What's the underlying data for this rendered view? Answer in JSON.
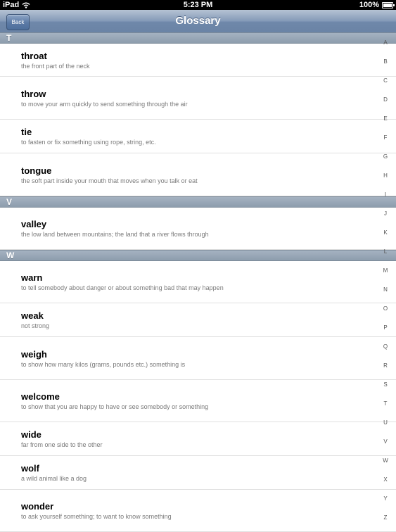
{
  "status_bar": {
    "device": "iPad",
    "time": "5:23 PM",
    "battery": "100%"
  },
  "nav": {
    "title": "Glossary",
    "back_label": "Back"
  },
  "sections": [
    {
      "letter": "T",
      "entries": [
        {
          "term": "throat",
          "definition": "the front part of the neck"
        },
        {
          "term": "throw",
          "definition": "to move your arm quickly to send something through the air"
        },
        {
          "term": "tie",
          "definition": "to fasten or fix something using rope, string, etc."
        },
        {
          "term": "tongue",
          "definition": "the soft part inside your mouth that moves when you talk or eat"
        }
      ]
    },
    {
      "letter": "V",
      "entries": [
        {
          "term": "valley",
          "definition": "the low land between mountains; the land that a river flows through"
        }
      ]
    },
    {
      "letter": "W",
      "entries": [
        {
          "term": "warn",
          "definition": "to tell somebody about danger or about something bad that may happen"
        },
        {
          "term": "weak",
          "definition": "not strong"
        },
        {
          "term": "weigh",
          "definition": "to show how many kilos (grams, pounds etc.) something is"
        },
        {
          "term": "welcome",
          "definition": "to show that you are happy to have or see somebody or something"
        },
        {
          "term": "wide",
          "definition": "far from one side to the other"
        },
        {
          "term": "wolf",
          "definition": "a wild animal like a dog"
        },
        {
          "term": "wonder",
          "definition": "to ask yourself something; to want to know something"
        }
      ]
    }
  ],
  "index": [
    "A",
    "B",
    "C",
    "D",
    "E",
    "F",
    "G",
    "H",
    "I",
    "J",
    "K",
    "L",
    "M",
    "N",
    "O",
    "P",
    "Q",
    "R",
    "S",
    "T",
    "U",
    "V",
    "W",
    "X",
    "Y",
    "Z"
  ]
}
